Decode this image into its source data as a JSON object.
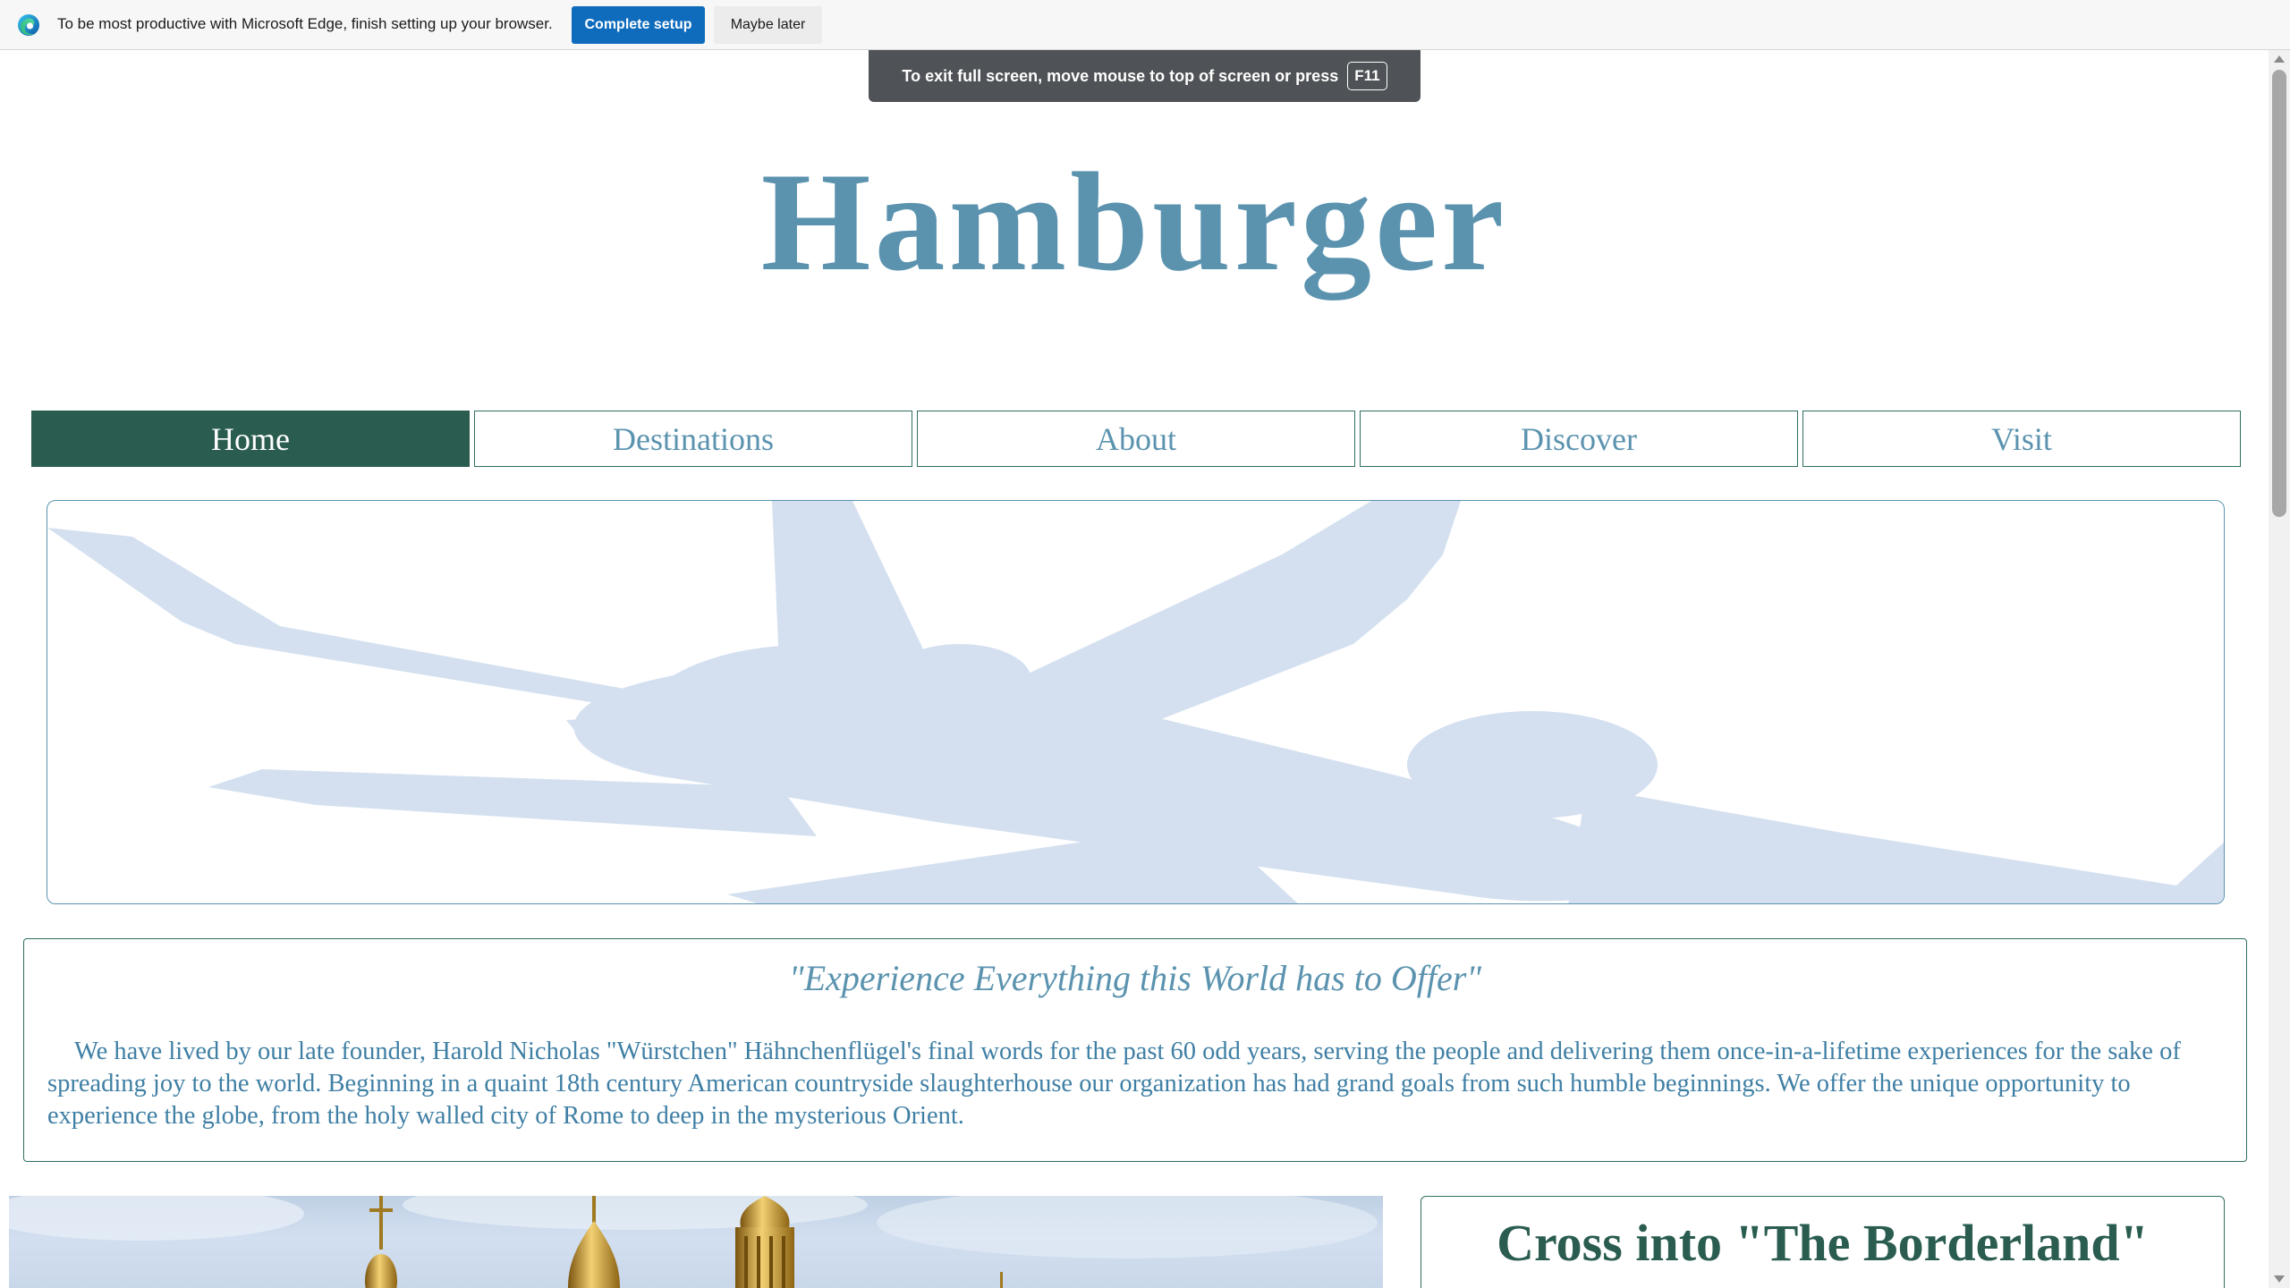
{
  "browser": {
    "setup_message": "To be most productive with Microsoft Edge, finish setting up your browser.",
    "complete_setup_label": "Complete setup",
    "maybe_later_label": "Maybe later",
    "fullscreen_notice": "To exit full screen, move mouse to top of screen or press",
    "fullscreen_key": "F11"
  },
  "site": {
    "title": "Hamburger"
  },
  "nav": {
    "tabs": [
      {
        "label": "Home",
        "active": true
      },
      {
        "label": "Destinations",
        "active": false
      },
      {
        "label": "About",
        "active": false
      },
      {
        "label": "Discover",
        "active": false
      },
      {
        "label": "Visit",
        "active": false
      }
    ]
  },
  "hero": {
    "image": "airplane-silhouette"
  },
  "intro": {
    "heading": "\"Experience Everything this World has to Offer\"",
    "body": "We have lived by our late founder, Harold Nicholas \"Würstchen\" Hähnchenflügel's final words for the past 60 odd years, serving the people and delivering them once-in-a-lifetime experiences for the sake of spreading joy to the world. Beginning in a quaint 18th century American countryside slaughterhouse our organization has had grand goals from such humble beginnings. We offer the unique opportunity to experience the globe, from the holy walled city of Rome to deep in the mysterious Orient."
  },
  "feature": {
    "image": "golden-domes-photo",
    "title": "Cross into \"The Borderland\""
  },
  "colors": {
    "accent": "#5b93af",
    "dark_green": "#2a5c50",
    "edge_blue": "#0f6cbd",
    "plane": "#d4e0f0"
  }
}
